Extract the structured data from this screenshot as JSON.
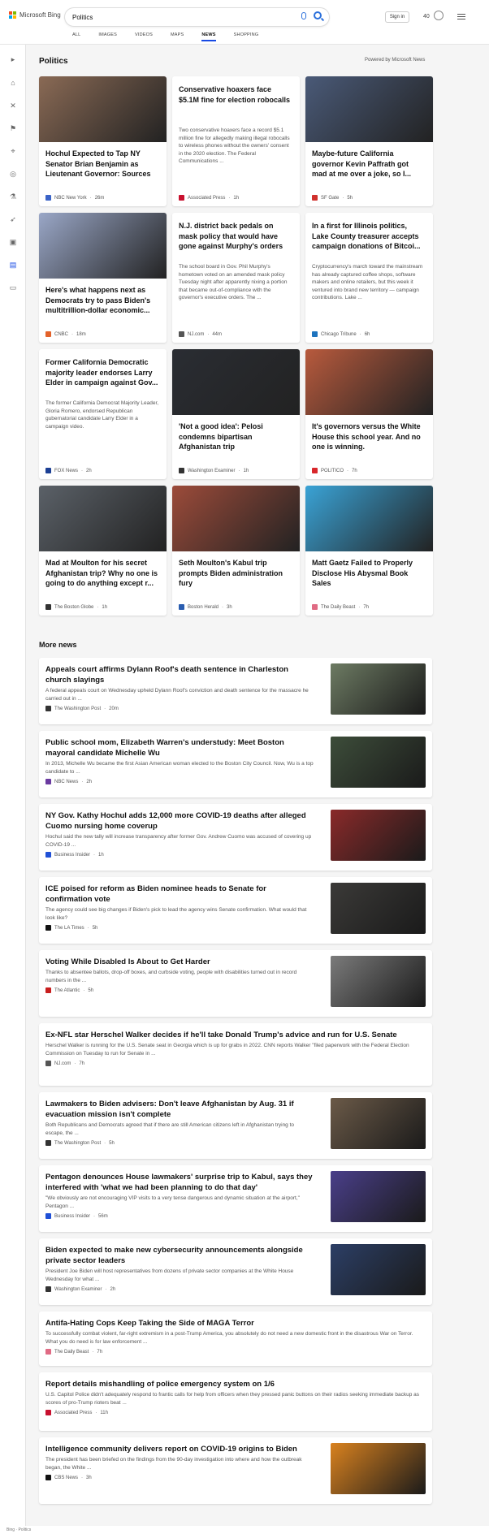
{
  "header": {
    "brand": "Microsoft Bing",
    "search_value": "Politics",
    "signin_label": "Sign in",
    "points": "40",
    "tabs": [
      "ALL",
      "IMAGES",
      "VIDEOS",
      "MAPS",
      "NEWS",
      "SHOPPING"
    ],
    "active_tab": "NEWS"
  },
  "section": {
    "title": "Politics",
    "powered_by": "Powered by Microsoft News"
  },
  "cards": [
    {
      "title": "Hochul Expected to Tap NY Senator Brian Benjamin as Lieutenant Governor: Sources",
      "source": "NBC New York",
      "time": "26m",
      "desc": "",
      "img": "#8a6a55",
      "logo": "#3a63c7"
    },
    {
      "title": "Conservative hoaxers face $5.1M fine for election robocalls",
      "source": "Associated Press",
      "time": "1h",
      "desc": "Two conservative hoaxers face a record $5.1 million fine for allegedly making illegal robocalls to wireless phones without the owners' consent in the 2020 election. The Federal Communications ...",
      "img": "",
      "logo": "#c8102e"
    },
    {
      "title": "Maybe-future California governor Kevin Paffrath got mad at me over a joke, so I...",
      "source": "SF Gate",
      "time": "5h",
      "desc": "",
      "img": "#4a5a78",
      "logo": "#d0312d"
    },
    {
      "title": "Here's what happens next as Democrats try to pass Biden's multitrillion-dollar economic...",
      "source": "CNBC",
      "time": "18m",
      "desc": "",
      "img": "#9aa7c7",
      "logo": "#e3622a"
    },
    {
      "title": "N.J. district back pedals on mask policy that would have gone against Murphy's orders",
      "source": "NJ.com",
      "time": "44m",
      "desc": "The school board in Gov. Phil Murphy's hometown voted on an amended mask policy Tuesday night after apparently nixing a portion that became out-of-compliance with the governor's executive orders. The ...",
      "img": "",
      "logo": "#555555"
    },
    {
      "title": "In a first for Illinois politics, Lake County treasurer accepts campaign donations of Bitcoi...",
      "source": "Chicago Tribune",
      "time": "6h",
      "desc": "Cryptocurrency's march toward the mainstream has already captured coffee shops, software makers and online retailers, but this week it ventured into brand new territory — campaign contributions. Lake ...",
      "img": "",
      "logo": "#1e73be"
    },
    {
      "title": "Former California Democratic majority leader endorses Larry Elder in campaign against Gov...",
      "source": "FOX News",
      "time": "2h",
      "desc": "The former California Democrat Majority Leader, Gloria Romero, endorsed Republican gubernatorial candidate Larry Elder in a campaign video.",
      "img": "",
      "logo": "#1c3f94"
    },
    {
      "title": "'Not a good idea': Pelosi condemns bipartisan Afghanistan trip",
      "source": "Washington Examiner",
      "time": "1h",
      "desc": "",
      "img": "#2a2d33",
      "logo": "#333333"
    },
    {
      "title": "It's governors versus the White House this school year. And no one is winning.",
      "source": "POLITICO",
      "time": "7h",
      "desc": "",
      "img": "#b85a3d",
      "logo": "#d8262b"
    },
    {
      "title": "Mad at Moulton for his secret Afghanistan trip? Why no one is going to do anything except r...",
      "source": "The Boston Globe",
      "time": "1h",
      "desc": "",
      "img": "#5b6168",
      "logo": "#333333"
    },
    {
      "title": "Seth Moulton's Kabul trip prompts Biden administration fury",
      "source": "Boston Herald",
      "time": "3h",
      "desc": "",
      "img": "#9c4b3a",
      "logo": "#2a5db0"
    },
    {
      "title": "Matt Gaetz Failed to Properly Disclose His Abysmal Book Sales",
      "source": "The Daily Beast",
      "time": "7h",
      "desc": "",
      "img": "#3aa3d6",
      "logo": "#e06b84"
    }
  ],
  "more_news": {
    "title": "More news",
    "items": [
      {
        "title": "Appeals court affirms Dylann Roof's death sentence in Charleston church slayings",
        "desc": "A federal appeals court on Wednesday upheld Dylann Roof's conviction and death sentence for the massacre he carried out in ...",
        "source": "The Washington Post",
        "time": "20m",
        "img": "#6d7b63",
        "logo": "#333333"
      },
      {
        "title": "Public school mom, Elizabeth Warren's understudy: Meet Boston mayoral candidate Michelle Wu",
        "desc": "In 2013, Michelle Wu became the first Asian American woman elected to the Boston City Council. Now, Wu is a top candidate to ...",
        "source": "NBC News",
        "time": "2h",
        "img": "#3d4d3a",
        "logo": "#6a3aa0"
      },
      {
        "title": "NY Gov. Kathy Hochul adds 12,000 more COVID-19 deaths after alleged Cuomo nursing home coverup",
        "desc": "Hochul said the new tally will increase transparency after former Gov. Andrew Cuomo was accused of covering up COVID-19 ...",
        "source": "Business Insider",
        "time": "1h",
        "img": "#8a2a2a",
        "logo": "#2050d6"
      },
      {
        "title": "ICE poised for reform as Biden nominee heads to Senate for confirmation vote",
        "desc": "The agency could see big changes if Biden's pick to lead the agency wins Senate confirmation. What would that look like?",
        "source": "The LA Times",
        "time": "5h",
        "img": "#3b3a38",
        "logo": "#111111"
      },
      {
        "title": "Voting While Disabled Is About to Get Harder",
        "desc": "Thanks to absentee ballots, drop-off boxes, and curbside voting, people with disabilities turned out in record numbers in the ...",
        "source": "The Atlantic",
        "time": "5h",
        "img": "#7b7b7b",
        "logo": "#c81e1e"
      },
      {
        "title": "Ex-NFL star Herschel Walker decides if he'll take Donald Trump's advice and run for U.S. Senate",
        "desc": "Herschel Walker is running for the U.S. Senate seat in Georgia which is up for grabs in 2022. CNN reports Walker \"filed paperwork with the Federal Election Commission on Tuesday to run for Senate in ...",
        "source": "NJ.com",
        "time": "7h",
        "img": "",
        "logo": "#555555"
      },
      {
        "title": "Lawmakers to Biden advisers: Don't leave Afghanistan by Aug. 31 if evacuation mission isn't complete",
        "desc": "Both Republicans and Democrats agreed that if there are still American citizens left in Afghanistan trying to escape, the ...",
        "source": "The Washington Post",
        "time": "5h",
        "img": "#6b5a48",
        "logo": "#333333"
      },
      {
        "title": "Pentagon denounces House lawmakers' surprise trip to Kabul, says they interfered with 'what we had been planning to do that day'",
        "desc": "\"We obviously are not encouraging VIP visits to a very tense dangerous and dynamic situation at the airport,\" Pentagon ...",
        "source": "Business Insider",
        "time": "56m",
        "img": "#4a3f8a",
        "logo": "#2050d6"
      },
      {
        "title": "Biden expected to make new cybersecurity announcements alongside private sector leaders",
        "desc": "President Joe Biden will host representatives from dozens of private sector companies at the White House Wednesday for what ...",
        "source": "Washington Examiner",
        "time": "2h",
        "img": "#2c3f66",
        "logo": "#333333"
      },
      {
        "title": "Antifa-Hating Cops Keep Taking the Side of MAGA Terror",
        "desc": "To successfully combat violent, far-right extremism in a post-Trump America, you absolutely do not need a new domestic front in the disastrous War on Terror. What you do need is for law enforcement ...",
        "source": "The Daily Beast",
        "time": "7h",
        "img": "",
        "logo": "#e06b84"
      },
      {
        "title": "Report details mishandling of police emergency system on 1/6",
        "desc": "U.S. Capitol Police didn't adequately respond to frantic calls for help from officers when they pressed panic buttons on their radios seeking immediate backup as scores of pro-Trump rioters beat ...",
        "source": "Associated Press",
        "time": "11h",
        "img": "",
        "logo": "#c8102e"
      },
      {
        "title": "Intelligence community delivers report on COVID-19 origins to Biden",
        "desc": "The president has been briefed on the findings from the 90-day investigation into where and how the outbreak began, the White ...",
        "source": "CBS News",
        "time": "3h",
        "img": "#d9821f",
        "logo": "#111111"
      }
    ]
  },
  "footer_text": "Bing · Politics"
}
